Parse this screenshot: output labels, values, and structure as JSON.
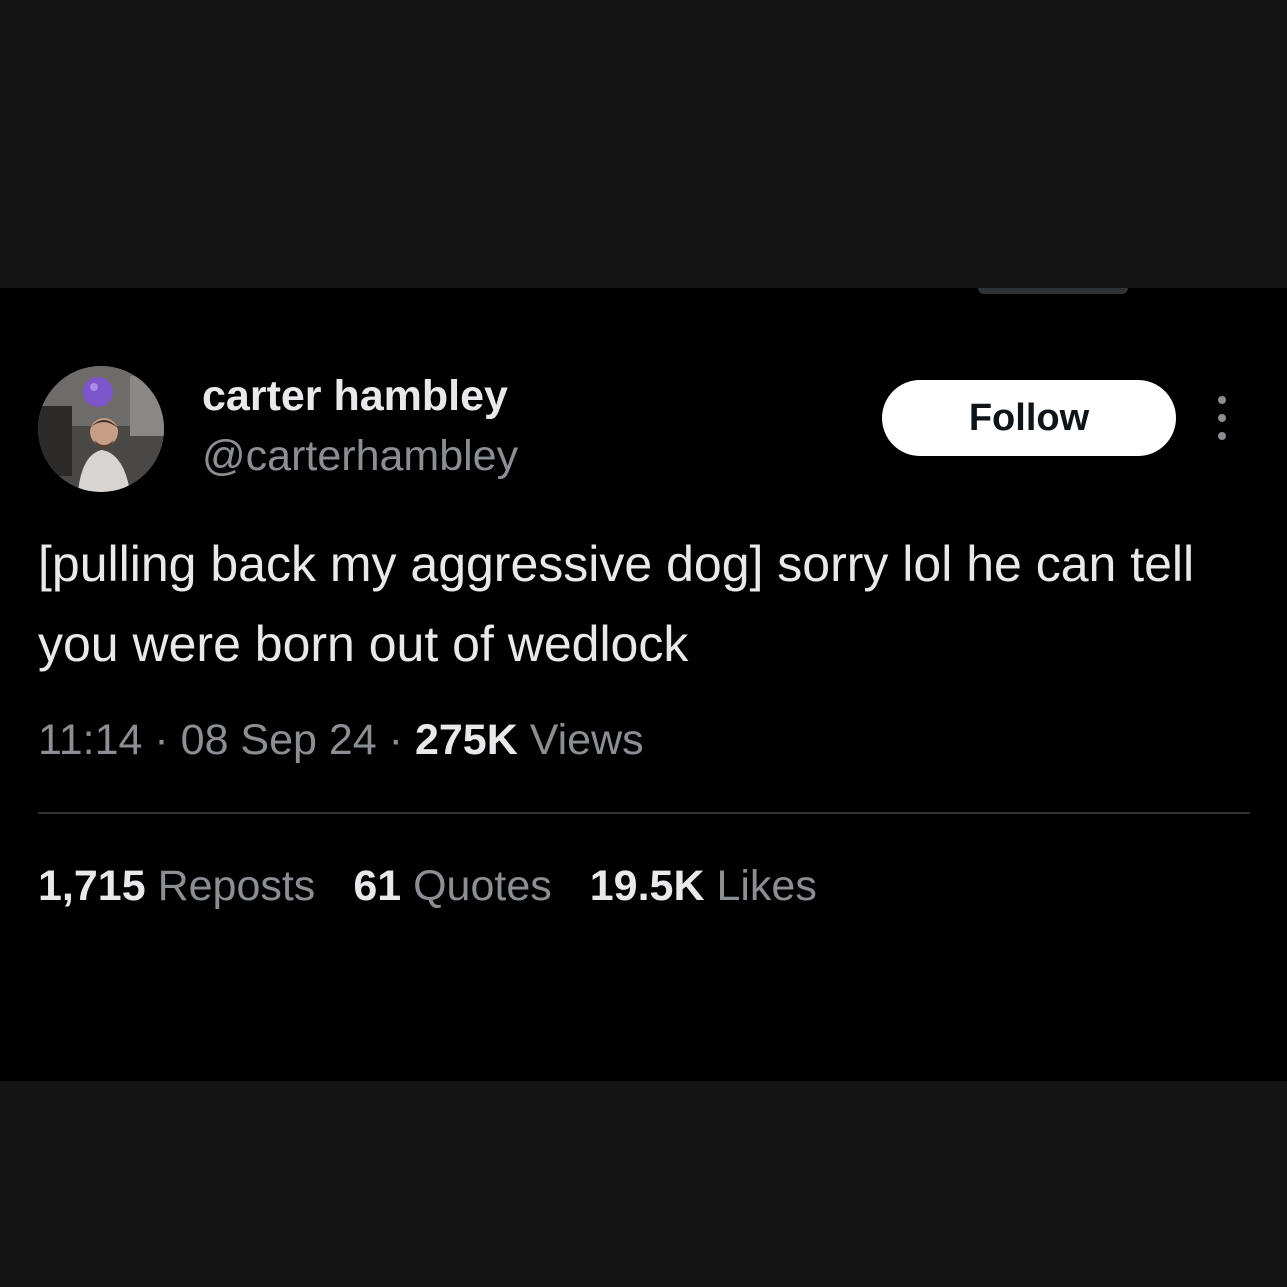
{
  "tweet": {
    "author": {
      "display_name": "carter hambley",
      "handle": "@carterhambley"
    },
    "follow_label": "Follow",
    "text": "[pulling back my aggressive dog] sorry lol he can tell you were born out of wedlock",
    "time": "11:14",
    "date": "08 Sep 24",
    "views_count": "275K",
    "views_label": "Views",
    "separator": "·",
    "stats": {
      "reposts_count": "1,715",
      "reposts_label": "Reposts",
      "quotes_count": "61",
      "quotes_label": "Quotes",
      "likes_count": "19.5K",
      "likes_label": "Likes"
    }
  },
  "icons": {
    "more": "vertical-ellipsis-icon"
  },
  "colors": {
    "background": "#000000",
    "outer_background": "#141414",
    "primary_text": "#e7e9ea",
    "secondary_text": "#8b8f94",
    "divider": "#2f3336",
    "follow_button_bg": "#ffffff",
    "follow_button_text": "#0f1419"
  }
}
